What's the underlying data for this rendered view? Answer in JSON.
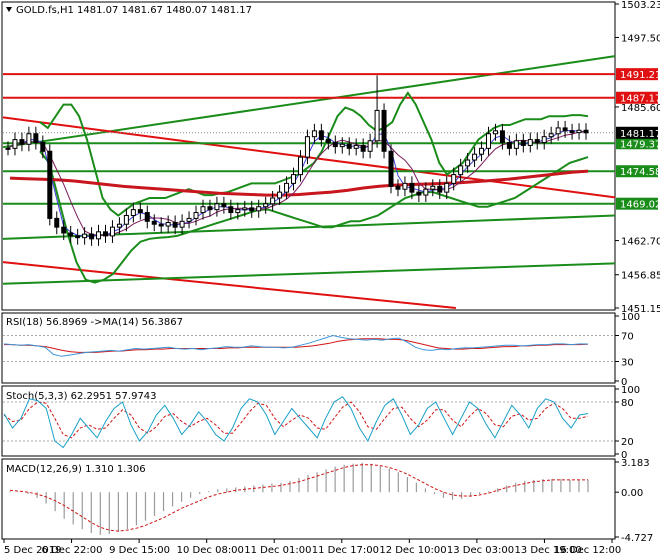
{
  "header": {
    "main": "GOLD.fs,H1  1481.07 1481.67 1480.07 1481.17",
    "rsi": "RSI(18) 56.8969  ->MA(14) 56.3867",
    "stoch": "Stoch(5,3,3) 62.2951 57.9743",
    "macd": "MACD(12,26,9) 1.310 1.306"
  },
  "colors": {
    "up": "#2a8a2a",
    "down": "#e01010",
    "price_badge": "#000000",
    "band": "#1a8c1a",
    "ma_fast": "#3a3ad6",
    "ma_slow": "#c8161e",
    "rsi_line": "#3c96d8",
    "rsi_ma": "#d21414",
    "stoch_main": "#1aa0c8",
    "stoch_signal": "#d21414",
    "macd_hist": "#9a9a9a",
    "macd_signal": "#d21414"
  },
  "chart_data": [
    {
      "type": "candlestick",
      "title": "GOLD.fs,H1",
      "ylim": [
        1451.15,
        1503.23
      ],
      "y_ticks": [
        "1503.23",
        "1497.50",
        "1491.21",
        "1487.17",
        "1485.60",
        "1481.17",
        "1479.37",
        "1474.58",
        "1469.02",
        "1462.70",
        "1456.85",
        "1451.15"
      ],
      "x_ticks": [
        "5 Dec 2019",
        "6 Dec 22:00",
        "9 Dec 15:00",
        "10 Dec 08:00",
        "11 Dec 01:00",
        "11 Dec 17:00",
        "12 Dec 10:00",
        "13 Dec 03:00",
        "13 Dec 19:00",
        "16 Dec 12:00"
      ],
      "last": {
        "open": 1481.07,
        "high": 1481.67,
        "low": 1480.07,
        "close": 1481.17
      },
      "horizontal_levels": [
        {
          "value": 1491.21,
          "color": "red",
          "label": "1491.21"
        },
        {
          "value": 1487.17,
          "color": "red",
          "label": "1487.17"
        },
        {
          "value": 1479.37,
          "color": "green",
          "label": "1479.37"
        },
        {
          "value": 1474.58,
          "color": "green",
          "label": "1474.58"
        },
        {
          "value": 1469.02,
          "color": "green",
          "label": "1469.02"
        }
      ],
      "trend_lines": [
        {
          "color": "green",
          "from": [
            0,
            1478.7
          ],
          "to": [
            1,
            1494.3
          ]
        },
        {
          "color": "red",
          "from": [
            0,
            1483.8
          ],
          "to": [
            1,
            1470.1
          ]
        },
        {
          "color": "red",
          "from": [
            0,
            1459.0
          ],
          "to": [
            0.74,
            1451.15
          ]
        },
        {
          "color": "green",
          "from": [
            0,
            1463.0
          ],
          "to": [
            1,
            1467.0
          ]
        },
        {
          "color": "green",
          "from": [
            0,
            1455.3
          ],
          "to": [
            1,
            1458.8
          ]
        }
      ],
      "series": [
        {
          "name": "Close",
          "points": [
            1478.5,
            1480.0,
            1479.2,
            1481.0,
            1479.5,
            1478.0,
            1466.5,
            1465.0,
            1464.0,
            1463.5,
            1463.2,
            1463.8,
            1463.0,
            1464.2,
            1463.5,
            1465.0,
            1465.5,
            1467.0,
            1468.0,
            1467.5,
            1466.0,
            1465.5,
            1465.2,
            1465.8,
            1465.0,
            1466.0,
            1466.5,
            1467.5,
            1468.5,
            1468.0,
            1469.0,
            1468.5,
            1467.5,
            1468.0,
            1468.3,
            1467.8,
            1468.5,
            1469.0,
            1470.0,
            1471.0,
            1472.5,
            1474.0,
            1477.0,
            1480.5,
            1481.5,
            1480.0,
            1479.5,
            1478.8,
            1479.2,
            1478.5,
            1479.0,
            1478.0,
            1479.8,
            1485.0,
            1478.0,
            1472.0,
            1471.5,
            1472.5,
            1471.0,
            1470.5,
            1471.5,
            1472.0,
            1471.0,
            1472.5,
            1474.0,
            1475.5,
            1476.5,
            1477.5,
            1478.5,
            1481.0,
            1481.5,
            1479.5,
            1478.5,
            1479.8,
            1479.0,
            1480.0,
            1479.5,
            1480.5,
            1481.0,
            1482.0,
            1481.5,
            1481.2,
            1481.6,
            1481.17
          ]
        },
        {
          "name": "Upper band",
          "points": [
            1483,
            1482,
            1484,
            1486,
            1486,
            1484,
            1480,
            1475,
            1470,
            1468,
            1467,
            1468,
            1469,
            1469.5,
            1470,
            1470,
            1470,
            1470.5,
            1471,
            1471.5,
            1471,
            1470.5,
            1470.5,
            1470.8,
            1471,
            1471.5,
            1472,
            1472.5,
            1472.5,
            1472.5,
            1472.5,
            1473,
            1473.5,
            1474,
            1475,
            1476,
            1478,
            1481,
            1484,
            1485.5,
            1485,
            1484,
            1482.5,
            1481.5,
            1482,
            1483,
            1486,
            1488,
            1486,
            1483,
            1480,
            1476,
            1474,
            1475,
            1476,
            1478,
            1480,
            1481,
            1482,
            1482.5,
            1482.5,
            1483,
            1483.5,
            1483.5,
            1483.5,
            1484,
            1484,
            1484,
            1484.2,
            1484.2,
            1484
          ]
        },
        {
          "name": "Lower band",
          "points": [
            1478,
            1476,
            1470,
            1464,
            1459,
            1456,
            1455.5,
            1456,
            1457,
            1459,
            1461,
            1462.5,
            1463,
            1463.2,
            1463.3,
            1463.5,
            1464,
            1464.5,
            1465,
            1465.5,
            1466,
            1466.5,
            1467,
            1467.5,
            1468,
            1468,
            1467.5,
            1467,
            1466.5,
            1466,
            1465.5,
            1465,
            1465,
            1465.5,
            1466,
            1466,
            1466.5,
            1467,
            1468,
            1469,
            1470,
            1470.5,
            1471,
            1471,
            1470.5,
            1470,
            1469.5,
            1469,
            1468.5,
            1468.5,
            1469,
            1469.5,
            1470,
            1471,
            1472,
            1473,
            1474,
            1475,
            1476,
            1476.5,
            1477
          ]
        },
        {
          "name": "Slow MA",
          "points": [
            1473.4,
            1473.3,
            1473.2,
            1473.1,
            1472.9,
            1472.6,
            1472.3,
            1472.0,
            1471.8,
            1471.6,
            1471.4,
            1471.2,
            1471.0,
            1470.8,
            1470.7,
            1470.6,
            1470.5,
            1470.5,
            1470.6,
            1470.8,
            1471.0,
            1471.3,
            1471.7,
            1472.0,
            1472.2,
            1472.3,
            1472.4,
            1472.5,
            1472.6,
            1472.8,
            1473.0,
            1473.2,
            1473.5,
            1473.8,
            1474.1,
            1474.4,
            1474.6
          ]
        }
      ]
    },
    {
      "type": "line",
      "title": "RSI(18) 56.8969  ->MA(14) 56.3867",
      "ylim": [
        0,
        100
      ],
      "y_ticks": [
        "100",
        "70",
        "30",
        "0"
      ],
      "levels": [
        70,
        30
      ],
      "series": [
        {
          "name": "RSI",
          "values": [
            57,
            56,
            55,
            56,
            54,
            52,
            41,
            38,
            40,
            42,
            44,
            45,
            46,
            47,
            46,
            48,
            50,
            49,
            50,
            51,
            52,
            50,
            49,
            50,
            48,
            50,
            51,
            53,
            52,
            52,
            54,
            53,
            52,
            52,
            51,
            52,
            55,
            58,
            62,
            66,
            70,
            67,
            65,
            64,
            63,
            64,
            63,
            65,
            66,
            60,
            52,
            48,
            47,
            49,
            48,
            50,
            51,
            51,
            52,
            53,
            54,
            55,
            55,
            54,
            55,
            56,
            56,
            57,
            57,
            56,
            57,
            56.9
          ]
        },
        {
          "name": "MA",
          "values": [
            56,
            56,
            55,
            55,
            54,
            53,
            50,
            47,
            45,
            44,
            44,
            44,
            45,
            46,
            46,
            47,
            48,
            48,
            49,
            49,
            50,
            50,
            50,
            50,
            50,
            50,
            50,
            51,
            51,
            52,
            52,
            52,
            52,
            52,
            52,
            52,
            53,
            54,
            56,
            58,
            61,
            63,
            64,
            65,
            65,
            65,
            64,
            64,
            63,
            60,
            57,
            54,
            51,
            50,
            49,
            49,
            50,
            50,
            51,
            52,
            53,
            53,
            54,
            54,
            55,
            55,
            56,
            56,
            56,
            56,
            56.4
          ]
        }
      ]
    },
    {
      "type": "line",
      "title": "Stoch(5,3,3) 62.2951 57.9743",
      "ylim": [
        0,
        100
      ],
      "y_ticks": [
        "100",
        "80",
        "20",
        "0"
      ],
      "levels": [
        80,
        20
      ],
      "series": [
        {
          "name": "Main",
          "values": [
            62,
            40,
            55,
            85,
            82,
            70,
            20,
            10,
            30,
            55,
            40,
            25,
            50,
            70,
            80,
            45,
            20,
            35,
            60,
            75,
            55,
            30,
            45,
            65,
            50,
            30,
            20,
            40,
            70,
            85,
            80,
            60,
            30,
            50,
            70,
            55,
            40,
            25,
            55,
            80,
            88,
            70,
            40,
            20,
            50,
            75,
            85,
            60,
            30,
            45,
            70,
            80,
            55,
            30,
            55,
            80,
            70,
            45,
            25,
            50,
            75,
            60,
            40,
            70,
            85,
            80,
            55,
            40,
            60,
            62.3
          ]
        },
        {
          "name": "Signal",
          "values": [
            60,
            50,
            52,
            70,
            80,
            78,
            55,
            30,
            25,
            40,
            45,
            38,
            40,
            55,
            68,
            60,
            40,
            32,
            42,
            58,
            62,
            50,
            42,
            50,
            55,
            45,
            32,
            32,
            48,
            65,
            78,
            75,
            55,
            42,
            52,
            60,
            55,
            40,
            38,
            55,
            72,
            80,
            65,
            42,
            38,
            55,
            70,
            72,
            55,
            42,
            52,
            68,
            68,
            52,
            42,
            58,
            70,
            62,
            45,
            42,
            58,
            62,
            52,
            55,
            70,
            78,
            70,
            55,
            55,
            58.0
          ]
        }
      ]
    },
    {
      "type": "bar",
      "title": "MACD(12,26,9) 1.310 1.306",
      "ylim": [
        -4.727,
        3.183
      ],
      "y_ticks": [
        "3.183",
        "0.00",
        "-4.727"
      ],
      "series": [
        {
          "name": "MACD",
          "values": [
            0.1,
            0.0,
            -0.2,
            -0.6,
            -1.2,
            -2.0,
            -2.8,
            -3.4,
            -3.9,
            -4.3,
            -4.5,
            -4.4,
            -4.2,
            -3.9,
            -3.5,
            -3.0,
            -2.5,
            -2.0,
            -1.5,
            -1.0,
            -0.6,
            -0.2,
            0.1,
            0.3,
            0.4,
            0.5,
            0.6,
            0.7,
            0.8,
            0.9,
            1.0,
            1.2,
            1.5,
            1.8,
            2.1,
            2.4,
            2.7,
            2.9,
            3.0,
            3.1,
            3.0,
            2.8,
            2.5,
            2.1,
            1.6,
            1.0,
            0.4,
            -0.2,
            -0.6,
            -0.8,
            -0.7,
            -0.5,
            -0.2,
            0.1,
            0.4,
            0.7,
            1.0,
            1.2,
            1.3,
            1.4,
            1.4,
            1.4,
            1.3,
            1.3,
            1.31
          ]
        },
        {
          "name": "Signal",
          "values": [
            0.2,
            0.1,
            0.0,
            -0.2,
            -0.5,
            -0.9,
            -1.4,
            -2.0,
            -2.6,
            -3.2,
            -3.7,
            -4.0,
            -4.1,
            -4.0,
            -3.8,
            -3.5,
            -3.1,
            -2.7,
            -2.2,
            -1.7,
            -1.3,
            -0.9,
            -0.5,
            -0.2,
            0.0,
            0.2,
            0.3,
            0.4,
            0.5,
            0.6,
            0.7,
            0.9,
            1.1,
            1.4,
            1.7,
            2.0,
            2.3,
            2.6,
            2.8,
            2.9,
            2.9,
            2.8,
            2.6,
            2.3,
            1.9,
            1.4,
            0.9,
            0.4,
            0.0,
            -0.3,
            -0.4,
            -0.4,
            -0.3,
            -0.1,
            0.2,
            0.5,
            0.7,
            0.9,
            1.1,
            1.2,
            1.3,
            1.3,
            1.3,
            1.3,
            1.306
          ]
        }
      ]
    }
  ]
}
